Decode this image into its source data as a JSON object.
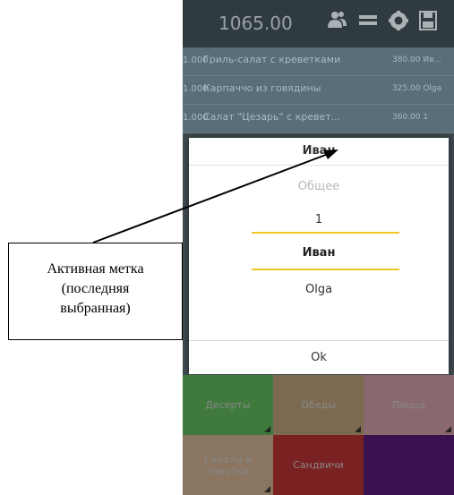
{
  "header": {
    "total": "1065.00",
    "icons": [
      "users-icon",
      "menu-icon",
      "gear-icon",
      "save-icon"
    ]
  },
  "order_rows": [
    {
      "qty": "1.000",
      "name": "Гриль-салат с креветками",
      "price": "380.00 Ив..."
    },
    {
      "qty": "1.000",
      "name": "Карпаччо из говядины",
      "price": "325.00 Olga"
    },
    {
      "qty": "1.000",
      "name": "Салат \"Цезарь\" с кревет...",
      "price": "360.00 1"
    }
  ],
  "dialog": {
    "title": "Иван",
    "items": [
      {
        "label": "Общее",
        "state": "faded"
      },
      {
        "label": "1",
        "state": "normal"
      },
      {
        "label": "Иван",
        "state": "selected"
      },
      {
        "label": "Olga",
        "state": "normal"
      }
    ],
    "ok_label": "Ok"
  },
  "categories": [
    {
      "label": "Десерты",
      "color": "#3f7a3c"
    },
    {
      "label": "Обеды",
      "color": "#7c6a50"
    },
    {
      "label": "Пицца",
      "color": "#8a6870"
    },
    {
      "label": "Салаты и закуски",
      "color": "#8a7560"
    },
    {
      "label": "Сандвичи",
      "color": "#7a2222"
    },
    {
      "label": "",
      "color": "#3a1250"
    }
  ],
  "callout": {
    "lines": [
      "Активная метка",
      "(последняя",
      "выбранная)"
    ]
  },
  "colors": {
    "selection_line": "#f2c624"
  }
}
